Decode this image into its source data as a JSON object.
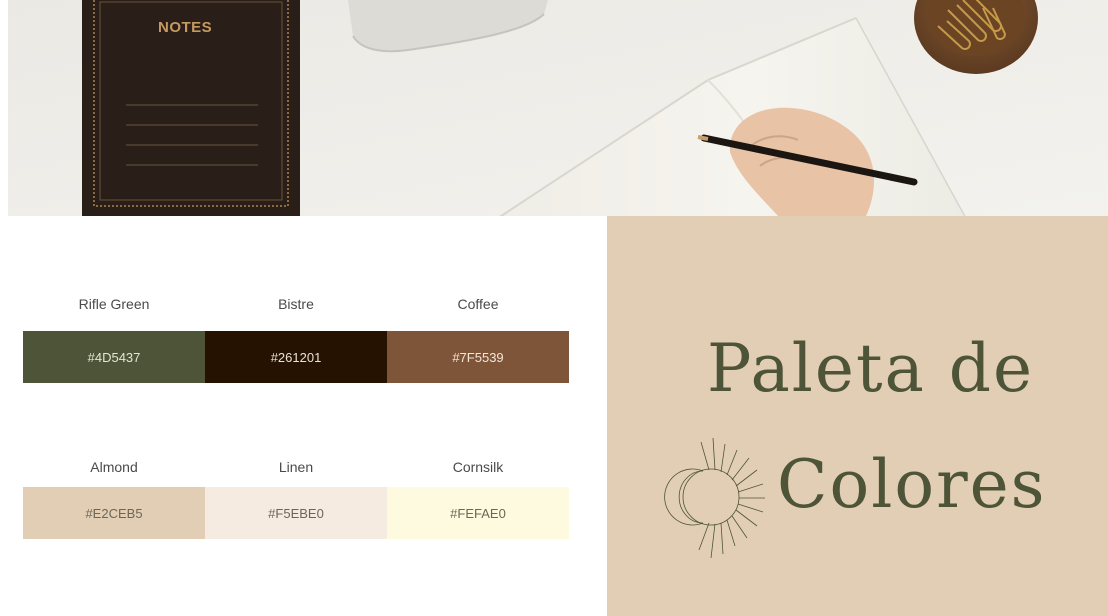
{
  "hero": {
    "notebook_label": "NOTES",
    "icons": [
      "notebook-image",
      "laptop-image",
      "paperclip-bowl-image",
      "hand-with-pencil-image",
      "open-notebook-image"
    ]
  },
  "palette": {
    "rows": [
      [
        {
          "name": "Rifle Green",
          "hex": "#4D5437",
          "color": "#4d5437",
          "text_color": "#e8e3d6"
        },
        {
          "name": "Bistre",
          "hex": "#261201",
          "color": "#261201",
          "text_color": "#e8e3d6"
        },
        {
          "name": "Coffee",
          "hex": "#7F5539",
          "color": "#7f5539",
          "text_color": "#f2e6d8"
        }
      ],
      [
        {
          "name": "Almond",
          "hex": "#E2CEB5",
          "color": "#e2ceb5",
          "text_color": "#6d6656"
        },
        {
          "name": "Linen",
          "hex": "#F5EBE0",
          "color": "#f5ebe0",
          "text_color": "#6d6656"
        },
        {
          "name": "Cornsilk",
          "hex": "#FEFAE0",
          "color": "#fefae0",
          "text_color": "#6d6656"
        }
      ]
    ]
  },
  "title": {
    "line1": "Paleta de",
    "line2": "Colores",
    "icon": "sun-moon-icon",
    "panel_color": "#e2ceb5",
    "text_color": "#4d5437"
  }
}
